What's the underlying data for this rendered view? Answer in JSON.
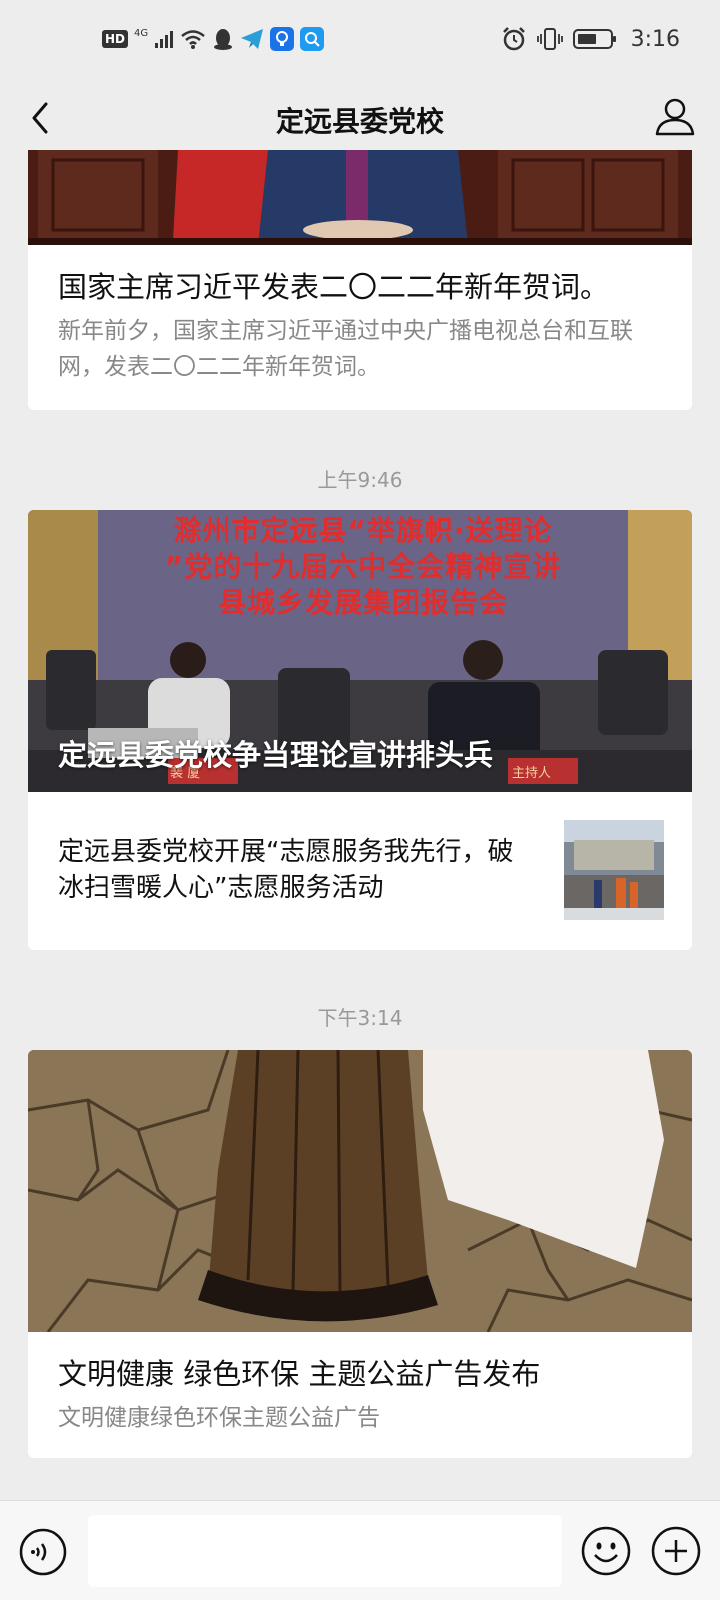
{
  "status_bar": {
    "hd": "HD",
    "network": "4G",
    "time": "3:16",
    "icons": [
      "signal-icon",
      "wifi-icon",
      "qq-icon",
      "telegram-icon",
      "bulb-app-icon",
      "search-app-icon",
      "alarm-icon",
      "vibrate-icon",
      "battery-icon"
    ]
  },
  "nav": {
    "title": "定远县委党校",
    "back_icon": "back-chevron-icon",
    "profile_icon": "user-icon"
  },
  "messages": [
    {
      "card_title": "国家主席习近平发表二〇二二年新年贺词。",
      "card_desc": "新年前夕，国家主席习近平通过中央广播电视总台和互联网，发表二〇二二年新年贺词。"
    },
    {
      "timestamp": "上午9:46",
      "banner_lines": [
        "滁州市定远县“举旗帜·送理论",
        "”党的十九届六中全会精神宣讲",
        "县城乡发展集团报告会"
      ],
      "cover_title": "定远县委党校争当理论宣讲排头兵",
      "nameplates": [
        "裴 厦",
        "主持人"
      ],
      "sub_item_title": "定远县委党校开展“志愿服务我先行，破冰扫雪暖人心”志愿服务活动"
    },
    {
      "timestamp": "下午3:14",
      "card_title": "文明健康 绿色环保 主题公益广告发布",
      "card_desc": "文明健康绿色环保主题公益广告"
    }
  ],
  "bottom_bar": {
    "voice_icon": "voice-icon",
    "emoji_icon": "emoji-icon",
    "plus_icon": "plus-icon"
  },
  "colors": {
    "background": "#ededed",
    "card": "#ffffff",
    "timestamp": "#999999",
    "banner_red": "#e12d2d"
  }
}
